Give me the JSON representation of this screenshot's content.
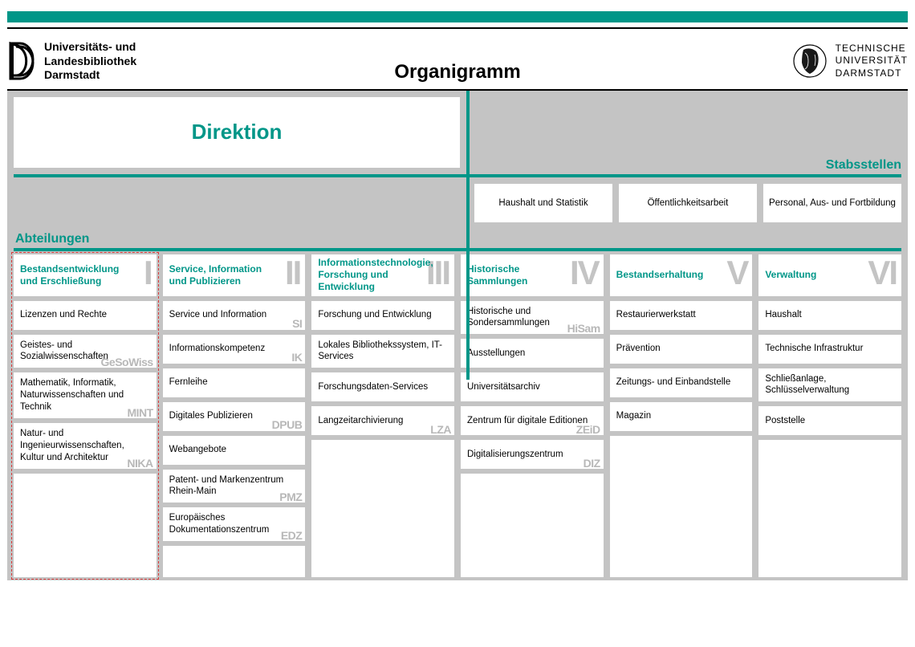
{
  "header": {
    "logo_left_line1": "Universitäts- und",
    "logo_left_line2": "Landesbibliothek",
    "logo_left_line3": "Darmstadt",
    "title": "Organigramm",
    "logo_right_line1": "TECHNISCHE",
    "logo_right_line2": "UNIVERSITÄT",
    "logo_right_line3": "DARMSTADT"
  },
  "direktion": "Direktion",
  "stabsstellen": {
    "label": "Stabsstellen",
    "items": [
      "Haushalt und Statistik",
      "Öffentlichkeitsarbeit",
      "Personal, Aus- und Fortbildung"
    ]
  },
  "abteilungen_label": "Abteilungen",
  "columns": [
    {
      "roman": "I",
      "title": "Bestandsentwicklung und Erschließung",
      "items": [
        {
          "label": "Lizenzen und Rechte",
          "abbr": ""
        },
        {
          "label": "Geistes- und Sozialwissenschaften",
          "abbr": "GeSoWiss"
        },
        {
          "label": "Mathematik, Informatik, Naturwissenschaften und Technik",
          "abbr": "MINT"
        },
        {
          "label": "Natur- und Ingenieurwissenschaften, Kultur und Architektur",
          "abbr": "NIKA"
        }
      ]
    },
    {
      "roman": "II",
      "title": "Service, Information und Publizieren",
      "items": [
        {
          "label": "Service und Information",
          "abbr": "SI"
        },
        {
          "label": "Informationskompetenz",
          "abbr": "IK"
        },
        {
          "label": "Fernleihe",
          "abbr": ""
        },
        {
          "label": "Digitales Publizieren",
          "abbr": "DPUB"
        },
        {
          "label": "Webangebote",
          "abbr": ""
        },
        {
          "label": "Patent- und Markenzentrum Rhein-Main",
          "abbr": "PMZ"
        },
        {
          "label": "Europäisches Dokumentationszentrum",
          "abbr": "EDZ"
        }
      ]
    },
    {
      "roman": "III",
      "title": "Informationstechnologie, Forschung und Entwicklung",
      "items": [
        {
          "label": "Forschung und Entwicklung",
          "abbr": ""
        },
        {
          "label": "Lokales Bibliothekssystem, IT-Services",
          "abbr": ""
        },
        {
          "label": "Forschungsdaten-Services",
          "abbr": ""
        },
        {
          "label": "Langzeitarchivierung",
          "abbr": "LZA"
        }
      ]
    },
    {
      "roman": "IV",
      "title": "Historische Sammlungen",
      "items": [
        {
          "label": "Historische und Sondersammlungen",
          "abbr": "HiSam"
        },
        {
          "label": "Ausstellungen",
          "abbr": ""
        },
        {
          "label": "Universitätsarchiv",
          "abbr": ""
        },
        {
          "label": "Zentrum für digitale Editionen",
          "abbr": "ZEiD"
        },
        {
          "label": "Digitalisierungszentrum",
          "abbr": "DIZ"
        }
      ]
    },
    {
      "roman": "V",
      "title": "Bestandserhaltung",
      "items": [
        {
          "label": "Restaurierwerkstatt",
          "abbr": ""
        },
        {
          "label": "Prävention",
          "abbr": ""
        },
        {
          "label": "Zeitungs- und Einbandstelle",
          "abbr": ""
        },
        {
          "label": "Magazin",
          "abbr": ""
        }
      ]
    },
    {
      "roman": "VI",
      "title": "Verwaltung",
      "items": [
        {
          "label": "Haushalt",
          "abbr": ""
        },
        {
          "label": "Technische Infrastruktur",
          "abbr": ""
        },
        {
          "label": "Schließanlage, Schlüsselverwaltung",
          "abbr": ""
        },
        {
          "label": "Poststelle",
          "abbr": ""
        }
      ]
    }
  ]
}
